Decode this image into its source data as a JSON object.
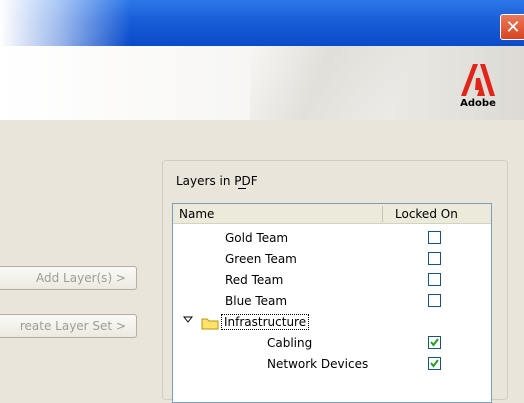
{
  "titlebar": {
    "close_icon": "close-icon"
  },
  "brand": {
    "logo_text": "Adobe"
  },
  "buttons": {
    "add_layers": "Add Layer(s)   >",
    "create_layer_set": "reate Layer Set  >"
  },
  "layers_panel": {
    "group_title": "Layers in PDF",
    "columns": {
      "name": "Name",
      "locked_on": "Locked On"
    },
    "rows": [
      {
        "label": "Gold Team",
        "locked": false
      },
      {
        "label": "Green Team",
        "locked": false
      },
      {
        "label": "Red Team",
        "locked": false
      },
      {
        "label": "Blue Team",
        "locked": false
      },
      {
        "label": "Infrastructure",
        "is_set": true,
        "expanded": true
      },
      {
        "label": "Cabling",
        "locked": true
      },
      {
        "label": "Network Devices",
        "locked": true
      }
    ]
  }
}
